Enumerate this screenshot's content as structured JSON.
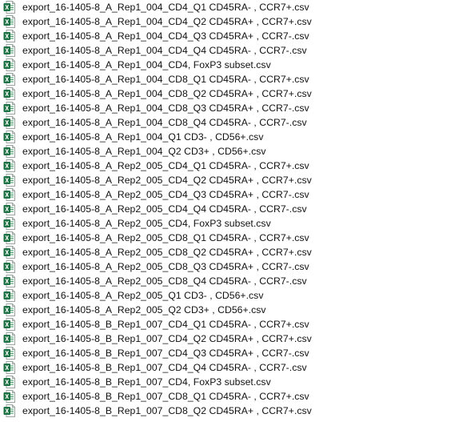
{
  "files": [
    {
      "name": "export_16-1405-8_A_Rep1_004_CD4_Q1 CD45RA- , CCR7+.csv",
      "icon": "excel-csv-icon"
    },
    {
      "name": "export_16-1405-8_A_Rep1_004_CD4_Q2 CD45RA+ , CCR7+.csv",
      "icon": "excel-csv-icon"
    },
    {
      "name": "export_16-1405-8_A_Rep1_004_CD4_Q3 CD45RA+ , CCR7-.csv",
      "icon": "excel-csv-icon"
    },
    {
      "name": "export_16-1405-8_A_Rep1_004_CD4_Q4 CD45RA- , CCR7-.csv",
      "icon": "excel-csv-icon"
    },
    {
      "name": "export_16-1405-8_A_Rep1_004_CD4, FoxP3 subset.csv",
      "icon": "excel-csv-icon"
    },
    {
      "name": "export_16-1405-8_A_Rep1_004_CD8_Q1 CD45RA- , CCR7+.csv",
      "icon": "excel-csv-icon"
    },
    {
      "name": "export_16-1405-8_A_Rep1_004_CD8_Q2 CD45RA+ , CCR7+.csv",
      "icon": "excel-csv-icon"
    },
    {
      "name": "export_16-1405-8_A_Rep1_004_CD8_Q3 CD45RA+ , CCR7-.csv",
      "icon": "excel-csv-icon"
    },
    {
      "name": "export_16-1405-8_A_Rep1_004_CD8_Q4 CD45RA- , CCR7-.csv",
      "icon": "excel-csv-icon"
    },
    {
      "name": "export_16-1405-8_A_Rep1_004_Q1 CD3- , CD56+.csv",
      "icon": "excel-csv-icon"
    },
    {
      "name": "export_16-1405-8_A_Rep1_004_Q2 CD3+ , CD56+.csv",
      "icon": "excel-csv-icon"
    },
    {
      "name": "export_16-1405-8_A_Rep2_005_CD4_Q1 CD45RA- , CCR7+.csv",
      "icon": "excel-csv-icon"
    },
    {
      "name": "export_16-1405-8_A_Rep2_005_CD4_Q2 CD45RA+ , CCR7+.csv",
      "icon": "excel-csv-icon"
    },
    {
      "name": "export_16-1405-8_A_Rep2_005_CD4_Q3 CD45RA+ , CCR7-.csv",
      "icon": "excel-csv-icon"
    },
    {
      "name": "export_16-1405-8_A_Rep2_005_CD4_Q4 CD45RA- , CCR7-.csv",
      "icon": "excel-csv-icon"
    },
    {
      "name": "export_16-1405-8_A_Rep2_005_CD4, FoxP3 subset.csv",
      "icon": "excel-csv-icon"
    },
    {
      "name": "export_16-1405-8_A_Rep2_005_CD8_Q1 CD45RA- , CCR7+.csv",
      "icon": "excel-csv-icon"
    },
    {
      "name": "export_16-1405-8_A_Rep2_005_CD8_Q2 CD45RA+ , CCR7+.csv",
      "icon": "excel-csv-icon"
    },
    {
      "name": "export_16-1405-8_A_Rep2_005_CD8_Q3 CD45RA+ , CCR7-.csv",
      "icon": "excel-csv-icon"
    },
    {
      "name": "export_16-1405-8_A_Rep2_005_CD8_Q4 CD45RA- , CCR7-.csv",
      "icon": "excel-csv-icon"
    },
    {
      "name": "export_16-1405-8_A_Rep2_005_Q1 CD3- , CD56+.csv",
      "icon": "excel-csv-icon"
    },
    {
      "name": "export_16-1405-8_A_Rep2_005_Q2 CD3+ , CD56+.csv",
      "icon": "excel-csv-icon"
    },
    {
      "name": "export_16-1405-8_B_Rep1_007_CD4_Q1 CD45RA- , CCR7+.csv",
      "icon": "excel-csv-icon"
    },
    {
      "name": "export_16-1405-8_B_Rep1_007_CD4_Q2 CD45RA+ , CCR7+.csv",
      "icon": "excel-csv-icon"
    },
    {
      "name": "export_16-1405-8_B_Rep1_007_CD4_Q3 CD45RA+ , CCR7-.csv",
      "icon": "excel-csv-icon"
    },
    {
      "name": "export_16-1405-8_B_Rep1_007_CD4_Q4 CD45RA- , CCR7-.csv",
      "icon": "excel-csv-icon"
    },
    {
      "name": "export_16-1405-8_B_Rep1_007_CD4, FoxP3 subset.csv",
      "icon": "excel-csv-icon"
    },
    {
      "name": "export_16-1405-8_B_Rep1_007_CD8_Q1 CD45RA- , CCR7+.csv",
      "icon": "excel-csv-icon"
    },
    {
      "name": "export_16-1405-8_B_Rep1_007_CD8_Q2 CD45RA+ , CCR7+.csv",
      "icon": "excel-csv-icon"
    }
  ],
  "colors": {
    "icon_green": "#1e7145",
    "icon_green_light": "#3a9a5f",
    "text": "#111111",
    "background": "#ffffff"
  }
}
